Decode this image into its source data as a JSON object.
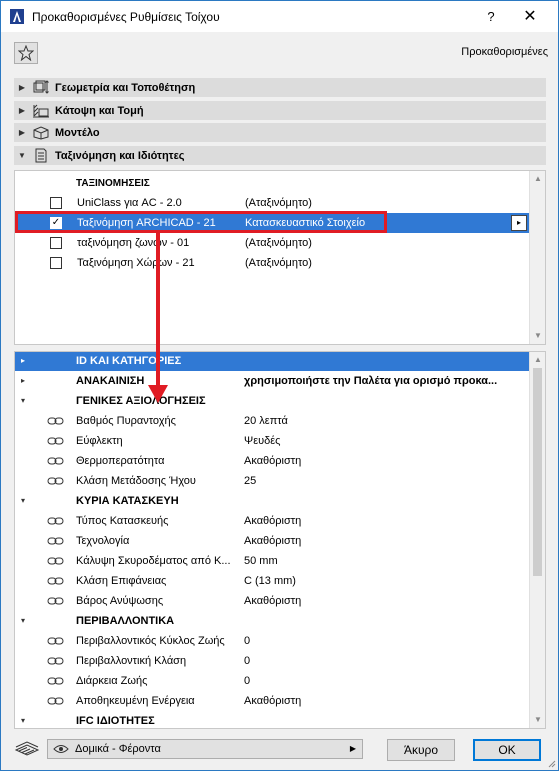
{
  "window": {
    "title": "Προκαθορισμένες Ρυθμίσεις Τοίχου",
    "help": "?",
    "close": "✕"
  },
  "favorites": {
    "defaults_label": "Προκαθορισμένες"
  },
  "panels": [
    {
      "label": "Γεωμετρία και Τοποθέτηση",
      "icon": "geometry-icon",
      "expanded": false
    },
    {
      "label": "Κάτοψη και Τομή",
      "icon": "floorplan-section-icon",
      "expanded": false
    },
    {
      "label": "Μοντέλο",
      "icon": "model-icon",
      "expanded": false
    },
    {
      "label": "Ταξινόμηση και Ιδιότητες",
      "icon": "classification-icon",
      "expanded": true
    }
  ],
  "classification": {
    "header": "ΤΑΞΙΝΟΜΗΣΕΙΣ",
    "rows": [
      {
        "name": "UniClass για AC - 2.0",
        "value": "(Αταξινόμητο)",
        "checked": false
      },
      {
        "name": "Ταξινόμηση ARCHICAD - 21",
        "value": "Κατασκευαστικό Στοιχείο",
        "checked": true
      },
      {
        "name": "ταξινόμηση ζωνών - 01",
        "value": "(Αταξινόμητο)",
        "checked": false
      },
      {
        "name": "Ταξινόμηση Χώρων - 21",
        "value": "(Αταξινόμητο)",
        "checked": false
      }
    ],
    "row_menu": "▸"
  },
  "properties": {
    "rows": [
      {
        "type": "group",
        "arrow": "▸",
        "name": "ID ΚΑΙ ΚΑΤΗΓΟΡΙΕΣ",
        "value": ""
      },
      {
        "type": "group",
        "arrow": "▸",
        "name": "ΑΝΑΚΑΙΝΙΣΗ",
        "value": "χρησιμοποιήστε την Παλέτα για ορισμό προκα..."
      },
      {
        "type": "group",
        "arrow": "▾",
        "name": "ΓΕΝΙΚΕΣ ΑΞΙΟΛΟΓΗΣΕΙΣ",
        "value": ""
      },
      {
        "type": "prop",
        "name": "Βαθμός Πυραντοχής",
        "value": "20 λεπτά"
      },
      {
        "type": "prop",
        "name": "Εύφλεκτη",
        "value": "Ψευδές"
      },
      {
        "type": "prop",
        "name": "Θερμοπερατότητα",
        "value": "Ακαθόριστη"
      },
      {
        "type": "prop",
        "name": "Κλάση Μετάδοσης Ήχου",
        "value": "25"
      },
      {
        "type": "group",
        "arrow": "▾",
        "name": "ΚΥΡΙΑ ΚΑΤΑΣΚΕΥΗ",
        "value": ""
      },
      {
        "type": "prop",
        "name": "Τύπος Κατασκευής",
        "value": "Ακαθόριστη"
      },
      {
        "type": "prop",
        "name": "Τεχνολογία",
        "value": "Ακαθόριστη"
      },
      {
        "type": "prop",
        "name": "Κάλυψη Σκυροδέματος από Κ...",
        "value": "50 mm"
      },
      {
        "type": "prop",
        "name": "Κλάση Επιφάνειας",
        "value": "C (13 mm)"
      },
      {
        "type": "prop",
        "name": "Βάρος Ανύψωσης",
        "value": "Ακαθόριστη"
      },
      {
        "type": "group",
        "arrow": "▾",
        "name": "ΠΕΡΙΒΑΛΛΟΝΤΙΚΑ",
        "value": ""
      },
      {
        "type": "prop",
        "name": "Περιβαλλοντικός Κύκλος Ζωής",
        "value": "0"
      },
      {
        "type": "prop",
        "name": "Περιβαλλοντική Κλάση",
        "value": "0"
      },
      {
        "type": "prop",
        "name": "Διάρκεια Ζωής",
        "value": "0"
      },
      {
        "type": "prop",
        "name": "Αποθηκευμένη Ενέργεια",
        "value": "Ακαθόριστη"
      },
      {
        "type": "group",
        "arrow": "▾",
        "name": "IFC ΙΔΙΟΤΗΤΕΣ",
        "value": ""
      }
    ]
  },
  "bottom": {
    "view_label": "Δομικά - Φέροντα",
    "cancel_label": "Άκυρο",
    "ok_label": "OK"
  },
  "colors": {
    "selection": "#3079d4",
    "annotation_red": "#e01c24",
    "panel_header": "#dcdcdc"
  }
}
